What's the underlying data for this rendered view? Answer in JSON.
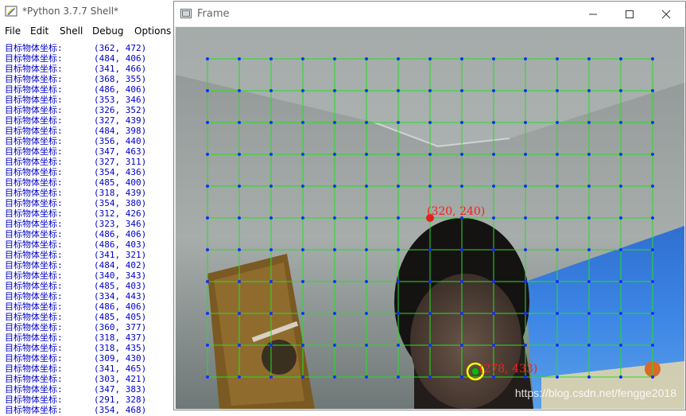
{
  "shell": {
    "title": "*Python 3.7.7 Shell*",
    "menu": [
      "File",
      "Edit",
      "Shell",
      "Debug",
      "Options"
    ],
    "label": "目标物体坐标:",
    "rows": [
      "(362, 472)",
      "(484, 406)",
      "(341, 466)",
      "(368, 355)",
      "(486, 406)",
      "(353, 346)",
      "(326, 352)",
      "(327, 439)",
      "(484, 398)",
      "(356, 440)",
      "(347, 463)",
      "(327, 311)",
      "(354, 436)",
      "(485, 400)",
      "(318, 439)",
      "(354, 380)",
      "(312, 426)",
      "(323, 346)",
      "(486, 406)",
      "(486, 403)",
      "(341, 321)",
      "(484, 402)",
      "(340, 343)",
      "(485, 403)",
      "(334, 443)",
      "(486, 406)",
      "(485, 405)",
      "(360, 377)",
      "(318, 437)",
      "(318, 435)",
      "(309, 430)",
      "(341, 465)",
      "(303, 421)",
      "(347, 383)",
      "(291, 328)",
      "(354, 468)"
    ]
  },
  "frame": {
    "title": "Frame",
    "center_label": "(320, 240)",
    "target_label": "(278, 433)",
    "watermark": "https://blog.csdn.net/fengge2018"
  },
  "colors": {
    "grid_line": "#22e022",
    "grid_dot": "#1a2cff",
    "center_marker": "#e02020",
    "label_text": "#ff1a1a",
    "target_ring": "#ffff00",
    "target_dot": "#00c000",
    "output_text": "#0000c8"
  },
  "icons": {
    "shell_icon": "python-feather-icon",
    "frame_icon": "window-icon",
    "minimize": "minimize-icon",
    "maximize": "maximize-icon",
    "close": "close-icon"
  }
}
